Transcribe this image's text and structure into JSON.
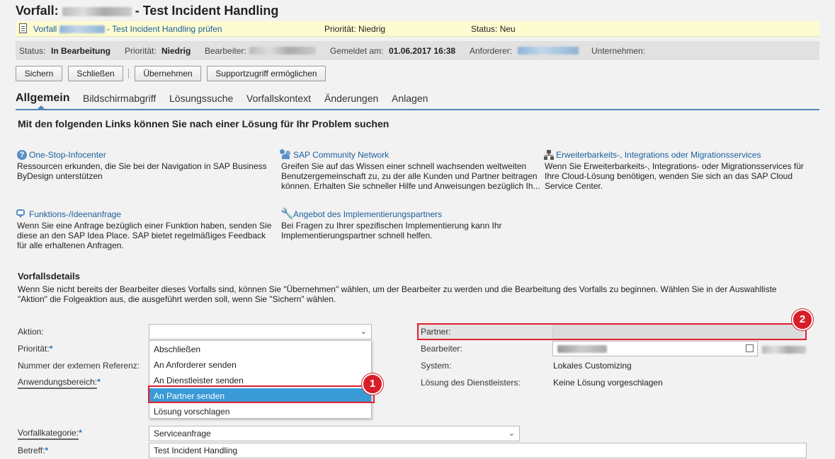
{
  "title": {
    "prefix": "Vorfall:",
    "suffix": "- Test Incident Handling"
  },
  "banner": {
    "link_prefix": "Vorfall",
    "link_suffix": "- Test Incident Handling prüfen",
    "priority": "Priorität: Niedrig",
    "status": "Status: Neu"
  },
  "info": {
    "status_label": "Status:",
    "status_value": "In Bearbeitung",
    "priority_label": "Priorität:",
    "priority_value": "Niedrig",
    "editor_label": "Bearbeiter:",
    "reported_label": "Gemeldet am:",
    "reported_value": "01.06.2017 16:38",
    "requester_label": "Anforderer:",
    "company_label": "Unternehmen:"
  },
  "toolbar": {
    "save": "Sichern",
    "close": "Schließen",
    "take_over": "Übernehmen",
    "support_access": "Supportzugriff ermöglichen"
  },
  "tabs": [
    "Allgemein",
    "Bildschirmabgriff",
    "Lösungssuche",
    "Vorfallskontext",
    "Änderungen",
    "Anlagen"
  ],
  "links_heading": "Mit den folgenden Links können Sie nach einer Lösung für Ihr Problem suchen",
  "links": [
    {
      "title": "One-Stop-Infocenter",
      "icon": "help-icon",
      "desc": [
        "Ressourcen erkunden, die Sie bei der Navigation in SAP Business",
        "ByDesign unterstützen"
      ]
    },
    {
      "title": "SAP Community Network",
      "icon": "community-icon",
      "desc": [
        "Greifen Sie auf das Wissen einer schnell wachsenden weltweiten",
        "Benutzergemeinschaft zu, zu der alle Kunden und Partner beitragen",
        "können. Erhalten Sie schneller Hilfe und Anweisungen bezüglich Ih..."
      ]
    },
    {
      "title": "Erweiterbarkeits-, Integrations oder Migrationsservices",
      "icon": "hierarchy-icon",
      "desc": [
        "Wenn Sie Erweiterbarkeits-, Integrations- oder Migrationsservices für",
        "Ihre Cloud-Lösung benötigen, wenden Sie sich an das SAP Cloud",
        "Service Center."
      ]
    },
    {
      "title": "Funktions-/Ideenanfrage",
      "icon": "idea-icon",
      "desc": [
        "Wenn Sie eine Anfrage bezüglich einer Funktion haben, senden Sie",
        "diese an den SAP Idea Place. SAP bietet regelmäßiges Feedback",
        "für alle erhaltenen Anfragen."
      ]
    },
    {
      "title": "Angebot des Implementierungspartners",
      "icon": "wrench-icon",
      "desc": [
        "Bei Fragen zu Ihrer spezifischen Implementierung kann Ihr",
        "Implementierungspartner schnell helfen."
      ]
    }
  ],
  "details": {
    "heading": "Vorfallsdetails",
    "intro": [
      "Wenn Sie nicht bereits der Bearbeiter dieses Vorfalls sind, können Sie \"Übernehmen\" wählen, um der Bearbeiter zu werden und die Bearbeitung des Vorfalls zu beginnen. Wählen Sie in der Auswahlliste",
      "\"Aktion\" die Folgeaktion aus, die ausgeführt werden soll, wenn Sie \"Sichern\" wählen."
    ],
    "action_label": "Aktion:",
    "priority_label": "Priorität:",
    "ext_ref_label": "Nummer der externen Referenz:",
    "area_label": "Anwendungsbereich:",
    "category_label": "Vorfallkategorie:",
    "category_value": "Serviceanfrage",
    "subject_label": "Betreff:",
    "subject_value": "Test Incident Handling",
    "partner_label": "Partner:",
    "editor_label": "Bearbeiter:",
    "system_label": "System:",
    "system_value": "Lokales Customizing",
    "provider_solution_label": "Lösung des Dienstleisters:",
    "provider_solution_value": "Keine Lösung vorgeschlagen",
    "required_mark": "*"
  },
  "dropdown_options": [
    "Abschließen",
    "An Anforderer senden",
    "An Dienstleister senden",
    "An Partner senden",
    "Lösung vorschlagen"
  ],
  "dropdown_selected_index": 3,
  "callouts": [
    "1",
    "2"
  ],
  "colors": {
    "accent": "#1a5f9c",
    "highlight": "#3a9ad6",
    "callout": "#d81e2a",
    "banner": "#fdfbd0"
  }
}
